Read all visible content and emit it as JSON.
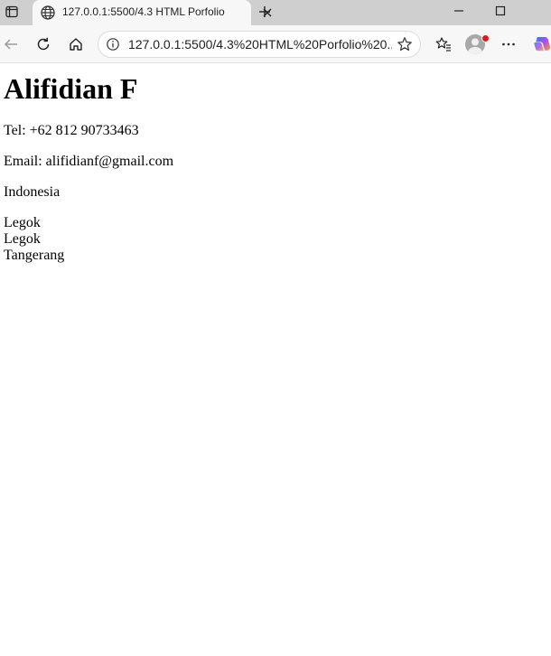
{
  "browser": {
    "tab": {
      "title": "127.0.0.1:5500/4.3 HTML Porfolio"
    },
    "address_bar": {
      "url": "127.0.0.1:5500/4.3%20HTML%20Porfolio%20..."
    },
    "icons": {
      "tab_actions": "tab-actions-icon",
      "favicon": "globe-icon",
      "close_tab": "close-icon",
      "new_tab": "plus-icon",
      "minimize": "minimize-icon",
      "maximize": "maximize-icon",
      "back": "back-arrow-icon",
      "refresh": "refresh-icon",
      "home": "home-icon",
      "site_info": "info-icon",
      "favorite": "star-icon",
      "favorites": "favorites-icon",
      "profile": "avatar-icon",
      "more": "more-icon",
      "copilot": "copilot-icon"
    },
    "colors": {
      "tabstrip": "#cfcfcf",
      "toolbar": "#f7f7f7",
      "notification_dot": "#d21f1f"
    }
  },
  "page": {
    "heading": "Alifidian F",
    "tel": "Tel: +62 812 90733463",
    "email": "Email: alifidianf@gmail.com",
    "country": "Indonesia",
    "address": [
      "Legok",
      "Legok",
      "Tangerang"
    ]
  }
}
